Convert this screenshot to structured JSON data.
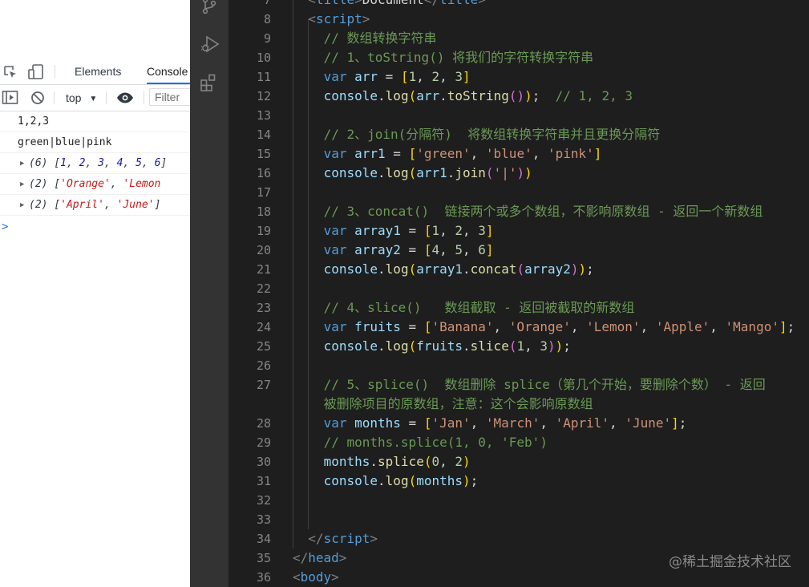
{
  "devtools": {
    "tabs": [
      "Elements",
      "Console"
    ],
    "active_tab": "Console",
    "toolbar": {
      "context": "top",
      "filter_placeholder": "Filter"
    },
    "console_lines": [
      {
        "kind": "text",
        "text": "1,2,3"
      },
      {
        "kind": "text",
        "text": "green|blue|pink"
      },
      {
        "kind": "array",
        "count": "(6)",
        "items": [
          "1",
          "2",
          "3",
          "4",
          "5",
          "6"
        ],
        "type": "num"
      },
      {
        "kind": "array",
        "count": "(2)",
        "items": [
          "'Orange'",
          "'Lemon"
        ],
        "type": "str",
        "truncated": true
      },
      {
        "kind": "array",
        "count": "(2)",
        "items": [
          "'April'",
          "'June'"
        ],
        "type": "str"
      }
    ],
    "prompt": ">"
  },
  "editor": {
    "watermark": "@稀土掘金技术社区",
    "lines": [
      {
        "n": "7",
        "indent": 1,
        "tokens": [
          [
            "brk",
            "<"
          ],
          [
            "tag",
            "title"
          ],
          [
            "brk",
            ">"
          ],
          [
            "txt",
            "Document"
          ],
          [
            "brk",
            "</"
          ],
          [
            "tag",
            "title"
          ],
          [
            "brk",
            ">"
          ]
        ]
      },
      {
        "n": "8",
        "indent": 1,
        "tokens": [
          [
            "brk",
            "<"
          ],
          [
            "tag",
            "script"
          ],
          [
            "brk",
            ">"
          ]
        ]
      },
      {
        "n": "9",
        "indent": 2,
        "tokens": [
          [
            "com",
            "// 数组转换字符串"
          ]
        ]
      },
      {
        "n": "10",
        "indent": 2,
        "tokens": [
          [
            "com",
            "// 1、toString() 将我们的字符转换字符串"
          ]
        ]
      },
      {
        "n": "11",
        "indent": 2,
        "tokens": [
          [
            "kw",
            "var "
          ],
          [
            "var",
            "arr"
          ],
          [
            "txt",
            " = "
          ],
          [
            "p1",
            "["
          ],
          [
            "num",
            "1"
          ],
          [
            "txt",
            ", "
          ],
          [
            "num",
            "2"
          ],
          [
            "txt",
            ", "
          ],
          [
            "num",
            "3"
          ],
          [
            "p1",
            "]"
          ]
        ]
      },
      {
        "n": "12",
        "indent": 2,
        "tokens": [
          [
            "var",
            "console"
          ],
          [
            "txt",
            "."
          ],
          [
            "fn",
            "log"
          ],
          [
            "p1",
            "("
          ],
          [
            "var",
            "arr"
          ],
          [
            "txt",
            "."
          ],
          [
            "fn",
            "toString"
          ],
          [
            "p2",
            "()"
          ],
          [
            "p1",
            ")"
          ],
          [
            "txt",
            ";  "
          ],
          [
            "com",
            "// 1, 2, 3"
          ]
        ]
      },
      {
        "n": "13",
        "indent": 2,
        "tokens": []
      },
      {
        "n": "14",
        "indent": 2,
        "tokens": [
          [
            "com",
            "// 2、join(分隔符)  将数组转换字符串并且更换分隔符"
          ]
        ]
      },
      {
        "n": "15",
        "indent": 2,
        "tokens": [
          [
            "kw",
            "var "
          ],
          [
            "var",
            "arr1"
          ],
          [
            "txt",
            " = "
          ],
          [
            "p1",
            "["
          ],
          [
            "str",
            "'green'"
          ],
          [
            "txt",
            ", "
          ],
          [
            "str",
            "'blue'"
          ],
          [
            "txt",
            ", "
          ],
          [
            "str",
            "'pink'"
          ],
          [
            "p1",
            "]"
          ]
        ]
      },
      {
        "n": "16",
        "indent": 2,
        "tokens": [
          [
            "var",
            "console"
          ],
          [
            "txt",
            "."
          ],
          [
            "fn",
            "log"
          ],
          [
            "p1",
            "("
          ],
          [
            "var",
            "arr1"
          ],
          [
            "txt",
            "."
          ],
          [
            "fn",
            "join"
          ],
          [
            "p2",
            "("
          ],
          [
            "str",
            "'|'"
          ],
          [
            "p2",
            ")"
          ],
          [
            "p1",
            ")"
          ]
        ]
      },
      {
        "n": "17",
        "indent": 2,
        "tokens": []
      },
      {
        "n": "18",
        "indent": 2,
        "tokens": [
          [
            "com",
            "// 3、concat()  链接两个或多个数组，不影响原数组 - 返回一个新数组"
          ]
        ]
      },
      {
        "n": "19",
        "indent": 2,
        "tokens": [
          [
            "kw",
            "var "
          ],
          [
            "var",
            "array1"
          ],
          [
            "txt",
            " = "
          ],
          [
            "p1",
            "["
          ],
          [
            "num",
            "1"
          ],
          [
            "txt",
            ", "
          ],
          [
            "num",
            "2"
          ],
          [
            "txt",
            ", "
          ],
          [
            "num",
            "3"
          ],
          [
            "p1",
            "]"
          ]
        ]
      },
      {
        "n": "20",
        "indent": 2,
        "tokens": [
          [
            "kw",
            "var "
          ],
          [
            "var",
            "array2"
          ],
          [
            "txt",
            " = "
          ],
          [
            "p1",
            "["
          ],
          [
            "num",
            "4"
          ],
          [
            "txt",
            ", "
          ],
          [
            "num",
            "5"
          ],
          [
            "txt",
            ", "
          ],
          [
            "num",
            "6"
          ],
          [
            "p1",
            "]"
          ]
        ]
      },
      {
        "n": "21",
        "indent": 2,
        "tokens": [
          [
            "var",
            "console"
          ],
          [
            "txt",
            "."
          ],
          [
            "fn",
            "log"
          ],
          [
            "p1",
            "("
          ],
          [
            "var",
            "array1"
          ],
          [
            "txt",
            "."
          ],
          [
            "fn",
            "concat"
          ],
          [
            "p2",
            "("
          ],
          [
            "var",
            "array2"
          ],
          [
            "p2",
            ")"
          ],
          [
            "p1",
            ")"
          ],
          [
            "txt",
            ";"
          ]
        ]
      },
      {
        "n": "22",
        "indent": 2,
        "tokens": []
      },
      {
        "n": "23",
        "indent": 2,
        "tokens": [
          [
            "com",
            "// 4、slice()   数组截取 - 返回被截取的新数组"
          ]
        ]
      },
      {
        "n": "24",
        "indent": 2,
        "tokens": [
          [
            "kw",
            "var "
          ],
          [
            "var",
            "fruits"
          ],
          [
            "txt",
            " = "
          ],
          [
            "p1",
            "["
          ],
          [
            "str",
            "'Banana'"
          ],
          [
            "txt",
            ", "
          ],
          [
            "str",
            "'Orange'"
          ],
          [
            "txt",
            ", "
          ],
          [
            "str",
            "'Lemon'"
          ],
          [
            "txt",
            ", "
          ],
          [
            "str",
            "'Apple'"
          ],
          [
            "txt",
            ", "
          ],
          [
            "str",
            "'Mango'"
          ],
          [
            "p1",
            "]"
          ],
          [
            "txt",
            ";"
          ]
        ]
      },
      {
        "n": "25",
        "indent": 2,
        "tokens": [
          [
            "var",
            "console"
          ],
          [
            "txt",
            "."
          ],
          [
            "fn",
            "log"
          ],
          [
            "p1",
            "("
          ],
          [
            "var",
            "fruits"
          ],
          [
            "txt",
            "."
          ],
          [
            "fn",
            "slice"
          ],
          [
            "p2",
            "("
          ],
          [
            "num",
            "1"
          ],
          [
            "txt",
            ", "
          ],
          [
            "num",
            "3"
          ],
          [
            "p2",
            ")"
          ],
          [
            "p1",
            ")"
          ],
          [
            "txt",
            ";"
          ]
        ]
      },
      {
        "n": "26",
        "indent": 2,
        "tokens": []
      },
      {
        "n": "27",
        "indent": 2,
        "tokens": [
          [
            "com",
            "// 5、splice()  数组删除 splice（第几个开始，要删除个数） - 返回"
          ]
        ]
      },
      {
        "n": "",
        "indent": 2,
        "tokens": [
          [
            "com",
            "被删除项目的原数组，注意：这个会影响原数组"
          ]
        ]
      },
      {
        "n": "28",
        "indent": 2,
        "tokens": [
          [
            "kw",
            "var "
          ],
          [
            "var",
            "months"
          ],
          [
            "txt",
            " = "
          ],
          [
            "p1",
            "["
          ],
          [
            "str",
            "'Jan'"
          ],
          [
            "txt",
            ", "
          ],
          [
            "str",
            "'March'"
          ],
          [
            "txt",
            ", "
          ],
          [
            "str",
            "'April'"
          ],
          [
            "txt",
            ", "
          ],
          [
            "str",
            "'June'"
          ],
          [
            "p1",
            "]"
          ],
          [
            "txt",
            ";"
          ]
        ]
      },
      {
        "n": "29",
        "indent": 2,
        "tokens": [
          [
            "com",
            "// months.splice(1, 0, 'Feb')"
          ]
        ]
      },
      {
        "n": "30",
        "indent": 2,
        "tokens": [
          [
            "var",
            "months"
          ],
          [
            "txt",
            "."
          ],
          [
            "fn",
            "splice"
          ],
          [
            "p1",
            "("
          ],
          [
            "num",
            "0"
          ],
          [
            "txt",
            ", "
          ],
          [
            "num",
            "2"
          ],
          [
            "p1",
            ")"
          ]
        ]
      },
      {
        "n": "31",
        "indent": 2,
        "tokens": [
          [
            "var",
            "console"
          ],
          [
            "txt",
            "."
          ],
          [
            "fn",
            "log"
          ],
          [
            "p1",
            "("
          ],
          [
            "var",
            "months"
          ],
          [
            "p1",
            ")"
          ],
          [
            "txt",
            ";"
          ]
        ]
      },
      {
        "n": "32",
        "indent": 2,
        "tokens": []
      },
      {
        "n": "33",
        "indent": 2,
        "tokens": []
      },
      {
        "n": "34",
        "indent": 1,
        "tokens": [
          [
            "brk",
            "</"
          ],
          [
            "tag",
            "script"
          ],
          [
            "brk",
            ">"
          ]
        ]
      },
      {
        "n": "35",
        "indent": 0,
        "tokens": [
          [
            "brk",
            "</"
          ],
          [
            "tag",
            "head"
          ],
          [
            "brk",
            ">"
          ]
        ]
      },
      {
        "n": "36",
        "indent": 0,
        "tokens": [
          [
            "brk",
            "<"
          ],
          [
            "tag",
            "body"
          ],
          [
            "brk",
            ">"
          ]
        ]
      }
    ]
  }
}
